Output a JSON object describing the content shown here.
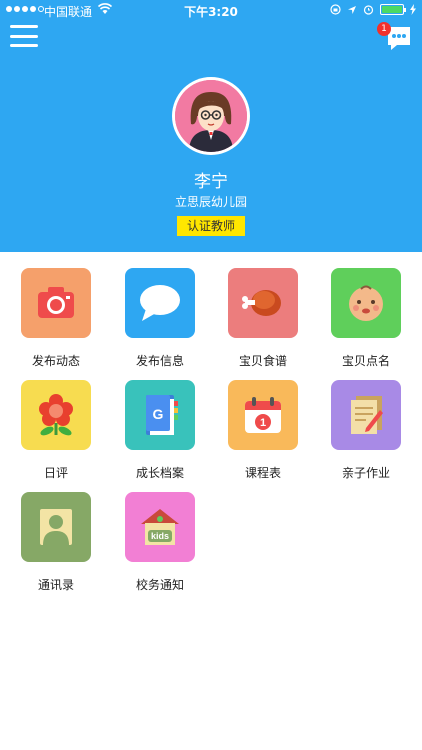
{
  "status": {
    "carrier": "中国联通",
    "time": "下午3:20"
  },
  "header": {
    "notification_count": "1",
    "user_name": "李宁",
    "school": "立思辰幼儿园",
    "role_badge": "认证教师"
  },
  "grid": [
    {
      "label": "发布动态",
      "icon": "camera-icon",
      "color": "#f5a06b"
    },
    {
      "label": "发布信息",
      "icon": "chat-bubble-icon",
      "color": "#2ea7f2"
    },
    {
      "label": "宝贝食谱",
      "icon": "chicken-leg-icon",
      "color": "#ec7d7d"
    },
    {
      "label": "宝贝点名",
      "icon": "baby-face-icon",
      "color": "#5fcf5b"
    },
    {
      "label": "日评",
      "icon": "flower-icon",
      "color": "#f7dc50"
    },
    {
      "label": "成长档案",
      "icon": "book-icon",
      "color": "#39c2bb"
    },
    {
      "label": "课程表",
      "icon": "calendar-icon",
      "color": "#f9b95a"
    },
    {
      "label": "亲子作业",
      "icon": "notebook-icon",
      "color": "#a88ae6"
    },
    {
      "label": "通讯录",
      "icon": "contact-icon",
      "color": "#86a866"
    },
    {
      "label": "校务通知",
      "icon": "kids-house-icon",
      "color": "#f27fd4"
    }
  ]
}
